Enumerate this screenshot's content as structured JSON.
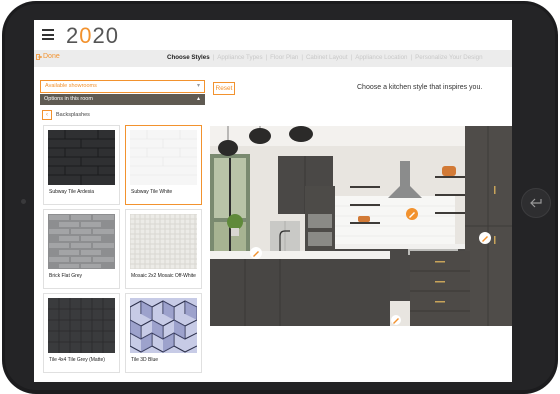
{
  "header": {
    "logo_pre": "2",
    "logo_o": "0",
    "logo_mid": "2",
    "logo_o2": "0",
    "menu_icon": "hamburger-icon"
  },
  "nav": {
    "done_label": "Done",
    "steps": [
      "Choose Styles",
      "Appliance Types",
      "Floor Plan",
      "Cabinet Layout",
      "Appliance Location",
      "Personalize Your Design"
    ],
    "active_step": 0
  },
  "filters": {
    "showroom_placeholder": "Available showrooms",
    "options_label": "Options in this room",
    "breadcrumb": "Backsplashes"
  },
  "tiles": [
    {
      "name": "Subway Tile Ardesia",
      "selected": false
    },
    {
      "name": "Subway Tile White",
      "selected": true
    },
    {
      "name": "Brick Flat Grey",
      "selected": false
    },
    {
      "name": "Mosaic 2x2 Mosaic Off-White",
      "selected": false
    },
    {
      "name": "Tile 4x4 Tile Grey (Matte)",
      "selected": false
    },
    {
      "name": "Tile 3D Blue",
      "selected": false
    }
  ],
  "main": {
    "reset_label": "Reset",
    "prompt": "Choose a kitchen style that inspires you."
  },
  "colors": {
    "accent": "#f2922e",
    "option_bar": "#5f5a52",
    "cabinet": "#4a4846"
  }
}
